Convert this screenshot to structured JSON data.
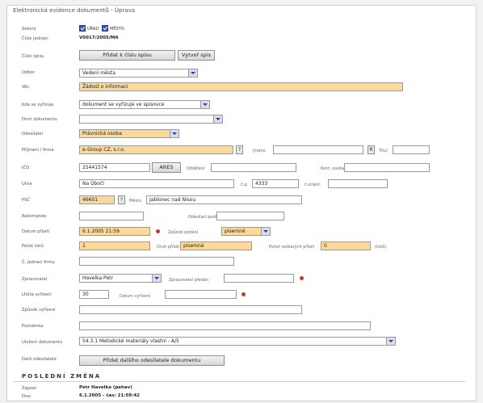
{
  "app": {
    "title": "Elektronická evidence dokumentů - Úprava"
  },
  "labels": {
    "sekory": "Sekory",
    "cislo_jednaci": "Číslo jednací",
    "cislo_spisu": "Číslo spisu",
    "odbor": "Odbor",
    "vec": "Věc",
    "kde_se_vyrizuje": "Kde se vyřizuje",
    "druh_dokumentu": "Druh dokumentu",
    "odesilatel": "Odesílatel",
    "prijmeni_firma": "Příjmení / firma",
    "jmeno": "Jméno",
    "titul": "Titul",
    "ico": "IČO",
    "oddeleni": "Oddělení",
    "kont_osoba": "Kont. osoba",
    "ulice": "Ulice",
    "cp": "č.p.",
    "c_orient": "č.orient.",
    "psc": "PSČ",
    "mesto": "Město",
    "rekomando": "Rekomando",
    "odesilaci_podle": "Odesílací podle",
    "datum_prijeti": "Datum přijetí",
    "zpusob_podani": "Způsob podání",
    "pocet_listu": "Počet listů",
    "druh_priloh": "Druh příloh",
    "pocet_vsech_priloh": "Počet veškerých příloh",
    "listu": "(listů)",
    "c_jednaci_firmy": "Č. jednací firmy",
    "zpracovatel": "Zpracovatel",
    "zpracovatel_predan": "Zpracovatel předán",
    "lhuta_vyrizeni": "Lhůta vyřízení",
    "datum_vyrizeni": "Datum vyřízení",
    "zpusob_vyrizeni": "Způsob vyřízení",
    "poznamka": "Poznámka",
    "ulozeni_dokumentu": "Uložení dokumentu",
    "dalsi_odesilatele": "Další odesílatelé"
  },
  "checkboxes": [
    {
      "label": "ÚŘAD",
      "checked": true
    },
    {
      "label": "MĚSTO",
      "checked": true
    }
  ],
  "values": {
    "cislo_jednaci": "V0017/2005/MA",
    "odbor": "Vedení města",
    "vec": "Žádost o informaci",
    "kde_se_vyrizuje": "dokument se vyřizuje ve spisovce",
    "druh_dokumentu": "",
    "odesilatel": "Právnická osoba",
    "prijmeni_firma": "e-Group CZ, s.r.o.",
    "jmeno": "",
    "titul": "",
    "ico": "25441574",
    "oddeleni": "",
    "kont_osoba": "",
    "ulice": "Na Úbočí",
    "cp": "4333",
    "c_orient": "",
    "psc": "46601",
    "mesto": "Jablonec nad Nisou",
    "rekomando": "",
    "odesilaci_podle": "",
    "datum_prijeti": "6.1.2005 21:59",
    "zpusob_podani": "písemně",
    "pocet_listu": "1",
    "druh_priloh": "písemné",
    "pocet_vsech_priloh": "0",
    "c_jednaci_firmy": "",
    "zpracovatel": "Havelka Petr",
    "zpracovatel_predan": "",
    "lhuta_vyrizeni": "30",
    "datum_vyrizeni": "",
    "zpusob_vyrizeni": "",
    "poznamka": "",
    "ulozeni_dokumentu": "54.3.1 Metodické materiály vlastní - A/5"
  },
  "buttons": {
    "pridat_k_cislu_spisu": "Přidat k číslu spisu",
    "vytvor_spis": "Vytvoř spis",
    "ares": "ARES",
    "psc_help": "?",
    "prijmeni_help": "?",
    "jmeno_help": "R",
    "pridat_dalsiho_odesilatele": "Přidat dalšího odesílatele dokumentu"
  },
  "last_change": {
    "heading": "POSLEDNÍ ZMĚNA",
    "zapsal_label": "Zapsal:",
    "zapsal_value": "Petr Havelka (pehav)",
    "dne_label": "Dne:",
    "dne_value": "6.1.2005 - čas: 21:59:42"
  },
  "colors": {
    "highlight": "#fbd99a",
    "accent": "#3f55b8",
    "required_dot": "#c9342b"
  }
}
